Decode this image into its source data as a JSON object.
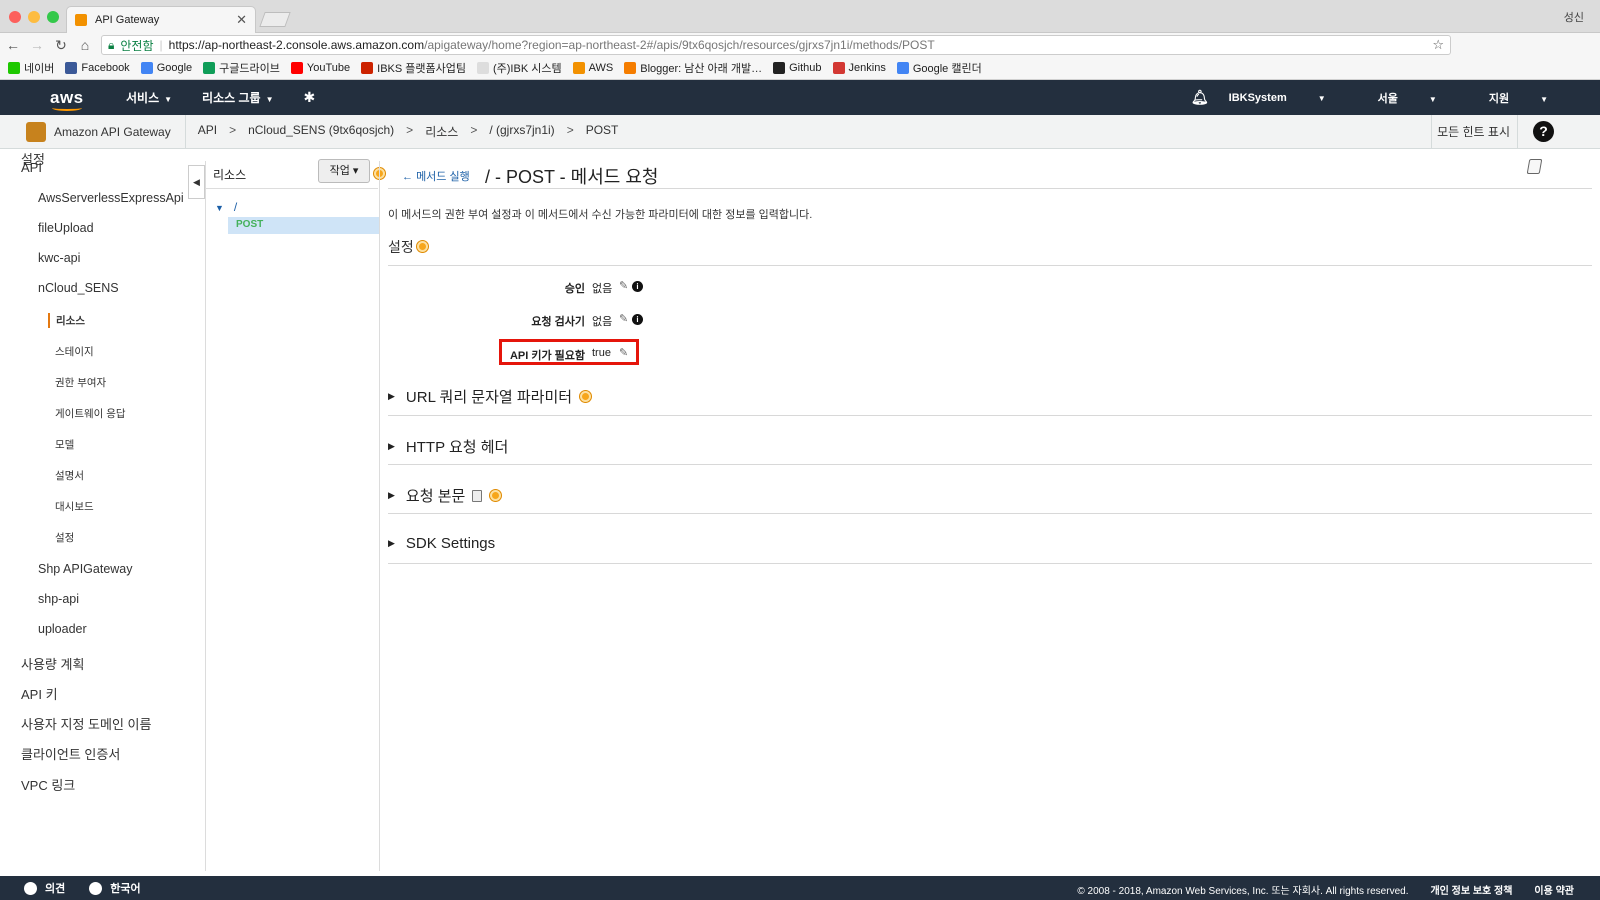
{
  "browser": {
    "tab_title": "API Gateway",
    "tab_close": "✕",
    "profile": "성신",
    "url_secure_label": "안전함",
    "url_host": "https://ap-northeast-2.console.aws.amazon.com",
    "url_path": "/apigateway/home?region=ap-northeast-2#/apis/9tx6qosjch/resources/gjrxs7jn1i/methods/POST",
    "bookmarks": [
      {
        "label": "네이버",
        "color": "#1ec800"
      },
      {
        "label": "Facebook",
        "color": "#3b5998"
      },
      {
        "label": "Google",
        "color": "#4285f4"
      },
      {
        "label": "구글드라이브",
        "color": "#0f9d58"
      },
      {
        "label": "YouTube",
        "color": "#ff0000"
      },
      {
        "label": "IBKS 플랫폼사업팀",
        "color": "#cc2200"
      },
      {
        "label": "(주)IBK 시스템",
        "color": "#dddddd"
      },
      {
        "label": "AWS",
        "color": "#f29100"
      },
      {
        "label": "Blogger: 남산 아래 개발…",
        "color": "#f57d00"
      },
      {
        "label": "Github",
        "color": "#222222"
      },
      {
        "label": "Jenkins",
        "color": "#d33833"
      },
      {
        "label": "Google 캘린더",
        "color": "#4285f4"
      }
    ]
  },
  "aws_nav": {
    "logo": "aws",
    "services": "서비스",
    "resource_groups": "리소스 그룹",
    "account": "IBKSystem",
    "region": "서울",
    "support": "지원"
  },
  "service_bar": {
    "service_name": "Amazon API Gateway",
    "breadcrumbs": [
      "API",
      "nCloud_SENS (9tx6qosjch)",
      "리소스",
      "/ (gjrxs7jn1i)",
      "POST"
    ],
    "breadcrumb_separator": ">",
    "show_hints": "모든 힌트 표시",
    "help": "?"
  },
  "left_nav": {
    "api_heading": "API",
    "apis": [
      "AwsServerlessExpressApi",
      "fileUpload",
      "kwc-api",
      "nCloud_SENS"
    ],
    "sub_items": [
      "리소스",
      "스테이지",
      "권한 부여자",
      "게이트웨이 응답",
      "모델",
      "설명서",
      "대시보드",
      "설정"
    ],
    "apis_after": [
      "Shp APIGateway",
      "shp-api",
      "uploader"
    ],
    "bottom": [
      "사용량 계획",
      "API 키",
      "사용자 지정 도메인 이름",
      "클라이언트 인증서",
      "VPC 링크",
      "설정"
    ]
  },
  "resources_panel": {
    "title": "리소스",
    "actions_button": "작업",
    "root": "/",
    "method": "POST"
  },
  "main": {
    "back_link": "메서드 실행",
    "title": "/ - POST - 메서드 요청",
    "description": "이 메서드의 권한 부여 설정과 이 메서드에서 수신 가능한 파라미터에 대한 정보를 입력합니다.",
    "settings_heading": "설정",
    "fields": [
      {
        "label": "승인",
        "value": "없음"
      },
      {
        "label": "요청 검사기",
        "value": "없음"
      },
      {
        "label": "API 키가 필요함",
        "value": "true"
      }
    ],
    "sections": [
      "URL 쿼리 문자열 파라미터",
      "HTTP 요청 헤더",
      "요청 본문",
      "SDK Settings"
    ]
  },
  "footer": {
    "feedback": "의견",
    "language": "한국어",
    "copyright": "© 2008 - 2018, Amazon Web Services, Inc. 또는 자회사. All rights reserved.",
    "privacy": "개인 정보 보호 정책",
    "terms": "이용 약관"
  },
  "colors": {
    "aws_nav_bg": "#232f3e",
    "aws_orange": "#ff9900",
    "link_blue": "#1b5fa7",
    "post_green": "#44b15b",
    "highlight_red": "#e5150b"
  }
}
